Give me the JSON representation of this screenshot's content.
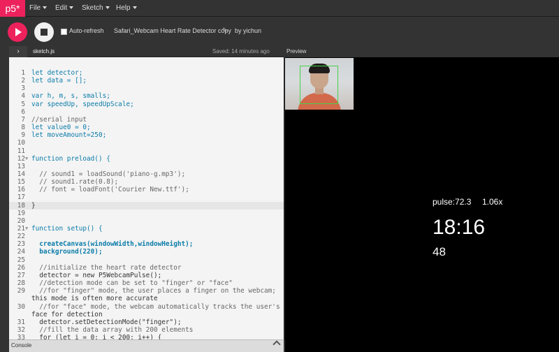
{
  "app": {
    "logo": "p5*"
  },
  "menu": [
    {
      "label": "File"
    },
    {
      "label": "Edit"
    },
    {
      "label": "Sketch"
    },
    {
      "label": "Help"
    }
  ],
  "toolbar": {
    "auto_refresh": "Auto-refresh",
    "sketch_name": "Safari_Webcam Heart Rate Detector copy",
    "by_user": "by yichun"
  },
  "editor": {
    "file": "sketch.js",
    "saved": "Saved: 14 minutes ago",
    "lines": [
      {
        "n": "1",
        "t": "let detector;"
      },
      {
        "n": "2",
        "t": "let data = [];"
      },
      {
        "n": "3",
        "t": ""
      },
      {
        "n": "4",
        "t": "var h, m, s, smalls;"
      },
      {
        "n": "5",
        "t": "var speedUp, speedUpScale;"
      },
      {
        "n": "6",
        "t": ""
      },
      {
        "n": "7",
        "t": "//serial input"
      },
      {
        "n": "8",
        "t": "let value0 = 0;"
      },
      {
        "n": "9",
        "t": "let moveAmount=250;"
      },
      {
        "n": "10",
        "t": ""
      },
      {
        "n": "11",
        "t": ""
      },
      {
        "n": "12",
        "t": "function preload() {"
      },
      {
        "n": "13",
        "t": ""
      },
      {
        "n": "14",
        "t": "  // sound1 = loadSound('piano-g.mp3');"
      },
      {
        "n": "15",
        "t": "  // sound1.rate(0.8);"
      },
      {
        "n": "16",
        "t": "  // font = loadFont('Courier New.ttf');"
      },
      {
        "n": "17",
        "t": ""
      },
      {
        "n": "18",
        "t": "}"
      },
      {
        "n": "19",
        "t": ""
      },
      {
        "n": "20",
        "t": ""
      },
      {
        "n": "21",
        "t": "function setup() {"
      },
      {
        "n": "22",
        "t": ""
      },
      {
        "n": "23",
        "t": "  createCanvas(windowWidth,windowHeight);"
      },
      {
        "n": "24",
        "t": "  background(220);"
      },
      {
        "n": "25",
        "t": ""
      },
      {
        "n": "26",
        "t": "  //initialize the heart rate detector"
      },
      {
        "n": "27",
        "t": "  detector = new P5WebcamPulse();"
      },
      {
        "n": "28",
        "t": "  //detection mode can be set to \"finger\" or \"face\""
      },
      {
        "n": "29",
        "t": "  //for \"finger\" mode, the user places a finger on the webcam;"
      },
      {
        "n": "",
        "t": "this mode is often more accurate"
      },
      {
        "n": "30",
        "t": "  //for \"face\" mode, the webcam automatically tracks the user's"
      },
      {
        "n": "",
        "t": "face for detection"
      },
      {
        "n": "31",
        "t": "  detector.setDetectionMode(\"finger\");"
      },
      {
        "n": "32",
        "t": "  //fill the data array with 200 elements"
      },
      {
        "n": "33",
        "t": "  for (let i = 0; i < 200; i++) {"
      }
    ]
  },
  "console": {
    "label": "Console"
  },
  "preview": {
    "label": "Preview",
    "pulse": "pulse:72.3",
    "ratio": "1.06x",
    "clock": "18:16",
    "count": "48"
  }
}
